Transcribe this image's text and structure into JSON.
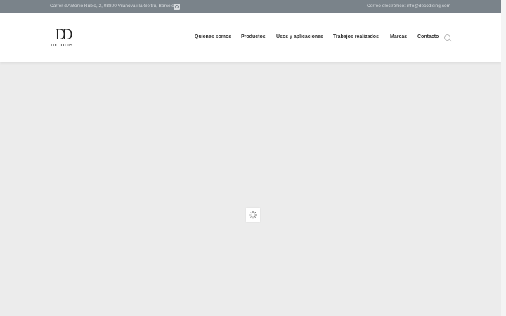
{
  "topbar": {
    "address": "Carrer d'Antonio Rubio, 2, 08800 Vilanova i la Geltrú, Barcelona",
    "email_text": "Correo electrónico: info@decodising.com",
    "social_icon": "instagram-icon"
  },
  "header": {
    "logo": {
      "mark": "DD",
      "word": "DECODIS"
    },
    "nav": [
      {
        "label": "Quienes somos"
      },
      {
        "label": "Productos"
      },
      {
        "label": "Usos y aplicaciones"
      },
      {
        "label": "Trabajos realizados"
      },
      {
        "label": "Marcas"
      },
      {
        "label": "Contacto"
      }
    ],
    "search_icon": "search-icon"
  },
  "colors": {
    "topbar_bg": "#7a838a",
    "content_bg": "#ececec",
    "header_bg": "#ffffff"
  },
  "loader_icon": "spinner-icon"
}
